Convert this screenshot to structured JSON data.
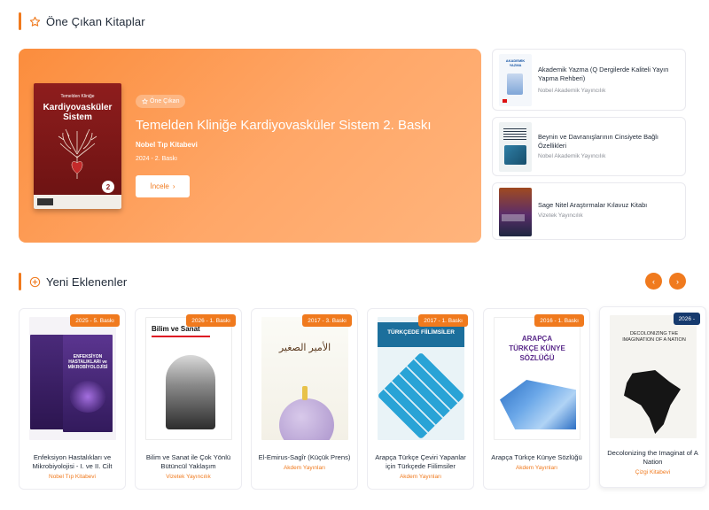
{
  "featured": {
    "section_title": "Öne Çıkan Kitaplar",
    "hero": {
      "badge": "Öne Çıkan",
      "title": "Temelden Kliniğe Kardiyovasküler Sistem 2. Baskı",
      "publisher": "Nobel Tıp Kitabevi",
      "year_edition": "2024 - 2. Baskı",
      "button_label": "İncele",
      "cover": {
        "top_text": "Temelden Kliniğe",
        "title": "Kardiyovasküler Sistem",
        "badge": "2"
      }
    },
    "side_items": [
      {
        "title": "Akademik Yazma (Q Dergilerde Kaliteli Yayın Yapma Rehberi)",
        "publisher": "Nobel Akademik Yayıncılık",
        "cover_text": "AKADEMİK YAZMA"
      },
      {
        "title": "Beynin ve Davranışlarının Cinsiyete Bağlı Özellikleri",
        "publisher": "Nobel Akademik Yayıncılık"
      },
      {
        "title": "Sage Nitel Araştırmalar Kılavuz Kitabı",
        "publisher": "Vizetek Yayıncılık"
      }
    ]
  },
  "recent": {
    "section_title": "Yeni Eklenenler",
    "books": [
      {
        "badge": "2025 - 5. Baskı",
        "title": "Enfeksiyon Hastalıkları ve Mikrobiyolojisi - I. ve II. Cilt",
        "publisher": "Nobel Tıp Kitabevi",
        "cover_text": "ENFEKSİYON HASTALIKLARI ve MİKROBİYOLOJİSİ"
      },
      {
        "badge": "2026 - 1. Baskı",
        "title": "Bilim ve Sanat ile Çok Yönlü Bütüncül Yaklaşım",
        "publisher": "Vizetek Yayıncılık",
        "cover_text": "Bilim ve Sanat"
      },
      {
        "badge": "2017 - 3. Baskı",
        "title": "El-Emirus-Sagîr (Küçük Prens)",
        "publisher": "Akdem Yayınları",
        "cover_text": "الأمير الصغير"
      },
      {
        "badge": "2017 - 1. Baskı",
        "title": "Arapça Türkçe Çeviri Yapanlar için Türkçede Fiilimsiler",
        "publisher": "Akdem Yayınları",
        "cover_text": "TÜRKÇEDE FİİLİMSİLER"
      },
      {
        "badge": "2016 - 1. Baskı",
        "title": "Arapça Türkçe Künye Sözlüğü",
        "publisher": "Akdem Yayınları",
        "cover_text": "ARAPÇA TÜRKÇE KÜNYE SÖZLÜĞÜ"
      },
      {
        "badge": "2026 -",
        "title": "Decolonizing the Imaginat of A Nation",
        "publisher": "Çizgi Kitabevi",
        "cover_text": "DECOLONIZING THE IMAGINATION OF A NATION"
      }
    ]
  },
  "colors": {
    "accent": "#f07a1e",
    "navy_badge": "#163a6e"
  }
}
